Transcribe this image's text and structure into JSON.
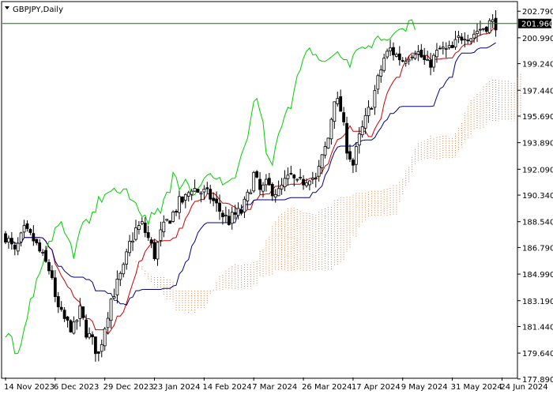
{
  "header": {
    "symbol_label": "GBPJPY,Daily",
    "menu_icon": "triangle-down-icon"
  },
  "colors": {
    "background": "#ffffff",
    "frame": "#000000",
    "candle": "#000000",
    "tenkan": "#cc0000",
    "kijun": "#000080",
    "chikou": "#00cc00",
    "cloud": "#d2691e",
    "price_line": "#008000",
    "price_tag_bg": "#000000",
    "price_tag_text": "#ffffff"
  },
  "chart_data": {
    "type": "candlestick",
    "title": "",
    "indicator": "Ichimoku Kinko Hyo",
    "price_axis": {
      "ylim": [
        177.99,
        203.39
      ],
      "ticks": [
        "202.790",
        "200.990",
        "199.240",
        "197.440",
        "195.690",
        "193.890",
        "192.090",
        "190.340",
        "188.540",
        "186.790",
        "184.990",
        "183.190",
        "181.440",
        "179.640",
        "177.890"
      ],
      "current_price": "201.960"
    },
    "time_axis": {
      "labels": [
        "14 Nov 2023",
        "6 Dec 2023",
        "29 Dec 2023",
        "23 Jan 2024",
        "14 Feb 2024",
        "7 Mar 2024",
        "26 Mar 2024",
        "17 Apr 2024",
        "9 May 2024",
        "31 May 2024",
        "24 Jun 2024"
      ],
      "label_bars": [
        0,
        16,
        32,
        48,
        64,
        80,
        96,
        112,
        128,
        144,
        160
      ]
    },
    "bars_visible": 166,
    "close_anchors": [
      [
        0,
        187.6
      ],
      [
        3,
        186.4
      ],
      [
        6,
        187.9
      ],
      [
        9,
        187.3
      ],
      [
        12,
        186.1
      ],
      [
        15,
        184.9
      ],
      [
        16,
        183.1
      ],
      [
        18,
        182.2
      ],
      [
        20,
        181.6
      ],
      [
        22,
        181.3
      ],
      [
        24,
        182.5
      ],
      [
        26,
        181.1
      ],
      [
        28,
        180.4
      ],
      [
        30,
        179.5
      ],
      [
        32,
        181.5
      ],
      [
        34,
        183.3
      ],
      [
        36,
        184.3
      ],
      [
        38,
        185.3
      ],
      [
        40,
        187.0
      ],
      [
        42,
        188.0
      ],
      [
        44,
        188.3
      ],
      [
        46,
        187.4
      ],
      [
        48,
        186.3
      ],
      [
        50,
        187.7
      ],
      [
        52,
        188.5
      ],
      [
        54,
        189.1
      ],
      [
        56,
        189.8
      ],
      [
        58,
        190.1
      ],
      [
        60,
        190.9
      ],
      [
        62,
        190.6
      ],
      [
        64,
        190.5
      ],
      [
        66,
        190.2
      ],
      [
        68,
        189.6
      ],
      [
        70,
        189.0
      ],
      [
        72,
        188.6
      ],
      [
        74,
        189.0
      ],
      [
        76,
        189.2
      ],
      [
        78,
        190.2
      ],
      [
        80,
        191.7
      ],
      [
        82,
        190.6
      ],
      [
        84,
        191.0
      ],
      [
        86,
        190.7
      ],
      [
        88,
        190.5
      ],
      [
        90,
        191.2
      ],
      [
        92,
        191.6
      ],
      [
        94,
        191.0
      ],
      [
        96,
        191.3
      ],
      [
        98,
        191.7
      ],
      [
        100,
        191.3
      ],
      [
        102,
        192.8
      ],
      [
        104,
        194.2
      ],
      [
        106,
        197.0
      ],
      [
        108,
        196.1
      ],
      [
        110,
        193.6
      ],
      [
        112,
        192.4
      ],
      [
        114,
        194.2
      ],
      [
        116,
        195.4
      ],
      [
        118,
        196.6
      ],
      [
        120,
        198.1
      ],
      [
        122,
        199.6
      ],
      [
        124,
        200.2
      ],
      [
        126,
        199.8
      ],
      [
        128,
        199.5
      ],
      [
        130,
        199.9
      ],
      [
        132,
        200.2
      ],
      [
        134,
        199.7
      ],
      [
        136,
        199.1
      ],
      [
        138,
        199.6
      ],
      [
        140,
        200.2
      ],
      [
        142,
        200.1
      ],
      [
        144,
        200.2
      ],
      [
        146,
        200.9
      ],
      [
        148,
        201.3
      ],
      [
        150,
        201.1
      ],
      [
        152,
        201.5
      ],
      [
        154,
        201.7
      ],
      [
        156,
        202.0
      ],
      [
        158,
        201.96
      ]
    ],
    "series": [
      {
        "name": "Tenkan-sen",
        "kind": "line"
      },
      {
        "name": "Kijun-sen",
        "kind": "line"
      },
      {
        "name": "Chikou Span",
        "kind": "line"
      },
      {
        "name": "Senkou Span A",
        "kind": "cloud-edge"
      },
      {
        "name": "Senkou Span B",
        "kind": "cloud-edge"
      }
    ],
    "grid": false,
    "legend": "none"
  }
}
